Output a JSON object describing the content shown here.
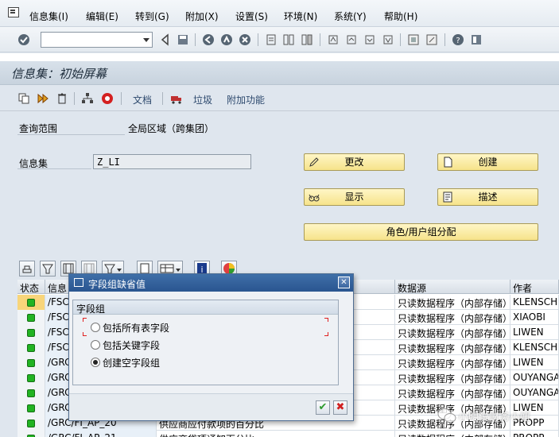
{
  "menu": [
    "信息集(I)",
    "编辑(E)",
    "转到(G)",
    "附加(X)",
    "设置(S)",
    "环境(N)",
    "系统(Y)",
    "帮助(H)"
  ],
  "command_field": {
    "value": ""
  },
  "title": "信息集：初始屏幕",
  "app_toolbar": {
    "doc": "文档",
    "trash": "垃圾",
    "extras": "附加功能"
  },
  "form": {
    "scope_label": "查询范围",
    "scope_value": "全局区域（跨集团）",
    "infoset_label": "信息集",
    "infoset_value": "Z_LI"
  },
  "buttons": {
    "change": "更改",
    "create": "创建",
    "display": "显示",
    "describe": "描述",
    "role_assign": "角色/用户组分配"
  },
  "grid": {
    "headers": {
      "status": "状态",
      "infoset": "信息",
      "source": "数据源",
      "author": "作者"
    },
    "rows": [
      {
        "name": "/FSC",
        "desc": "",
        "source": "只读数据程序（内部存储）",
        "author": "KLENSCH"
      },
      {
        "name": "/FSC",
        "desc": "",
        "source": "只读数据程序（内部存储）",
        "author": "XIAOBI"
      },
      {
        "name": "/FSC",
        "desc": "",
        "source": "只读数据程序（内部存储）",
        "author": "LIWEN"
      },
      {
        "name": "/FSC",
        "desc": "",
        "source": "只读数据程序（内部存储）",
        "author": "KLENSCH"
      },
      {
        "name": "/GRC",
        "desc": "",
        "source": "只读数据程序（内部存储）",
        "author": "LIWEN"
      },
      {
        "name": "/GRC",
        "desc": "",
        "source": "只读数据程序（内部存储）",
        "author": "OUYANGA"
      },
      {
        "name": "/GRC",
        "desc": "",
        "source": "只读数据程序（内部存储）",
        "author": "OUYANGA"
      },
      {
        "name": "/GRC",
        "desc": "",
        "source": "只读数据程序（内部存储）",
        "author": "LIWEN"
      },
      {
        "name": "/GRC/FI_AP_20",
        "desc": "供应商应付款项的百分比",
        "source": "只读数据程序（内部存储）",
        "author": "PROPP"
      },
      {
        "name": "/GRC/FI_AP_21",
        "desc": "供应商贷项通知百分比",
        "source": "只读数据程序（内部存储）",
        "author": "PROPP"
      }
    ]
  },
  "dialog": {
    "title": "字段组缺省值",
    "group_title": "字段组",
    "options": [
      "包括所有表字段",
      "包括关键字段",
      "创建空字段组"
    ],
    "selected_index": 2
  },
  "watermark": "小明说财务小妞",
  "colors": {
    "led_green": "#22b322",
    "dialog_title": "#2a5590",
    "yellow_button": "#f6e38a"
  }
}
